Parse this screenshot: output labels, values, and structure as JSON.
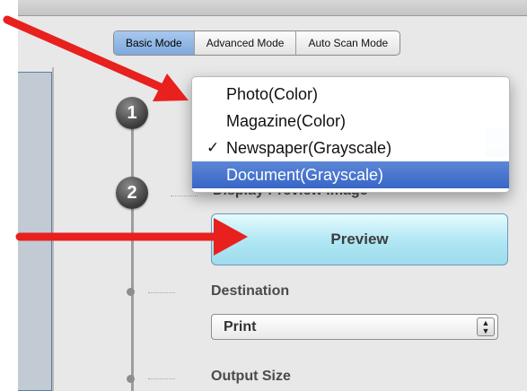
{
  "mode_tabs": [
    {
      "label": "Basic Mode",
      "active": true
    },
    {
      "label": "Advanced Mode",
      "active": false
    },
    {
      "label": "Auto Scan Mode",
      "active": false
    }
  ],
  "steps": {
    "step1_number": "1",
    "step2_number": "2",
    "step2_label": "Display Preview Image"
  },
  "document_type_menu": {
    "items": [
      {
        "label": "Photo(Color)",
        "checked": false,
        "highlighted": false
      },
      {
        "label": "Magazine(Color)",
        "checked": false,
        "highlighted": false
      },
      {
        "label": "Newspaper(Grayscale)",
        "checked": true,
        "highlighted": false
      },
      {
        "label": "Document(Grayscale)",
        "checked": false,
        "highlighted": true
      }
    ],
    "check_glyph": "✓"
  },
  "preview_button": {
    "label": "Preview"
  },
  "destination": {
    "label": "Destination",
    "value": "Print",
    "stepper_up": "▲",
    "stepper_down": "▼"
  },
  "output_size": {
    "label": "Output Size"
  },
  "colors": {
    "arrow": "#e8201e",
    "menu_highlight": "#3f6fcb",
    "preview_button": "#aee6f3"
  }
}
